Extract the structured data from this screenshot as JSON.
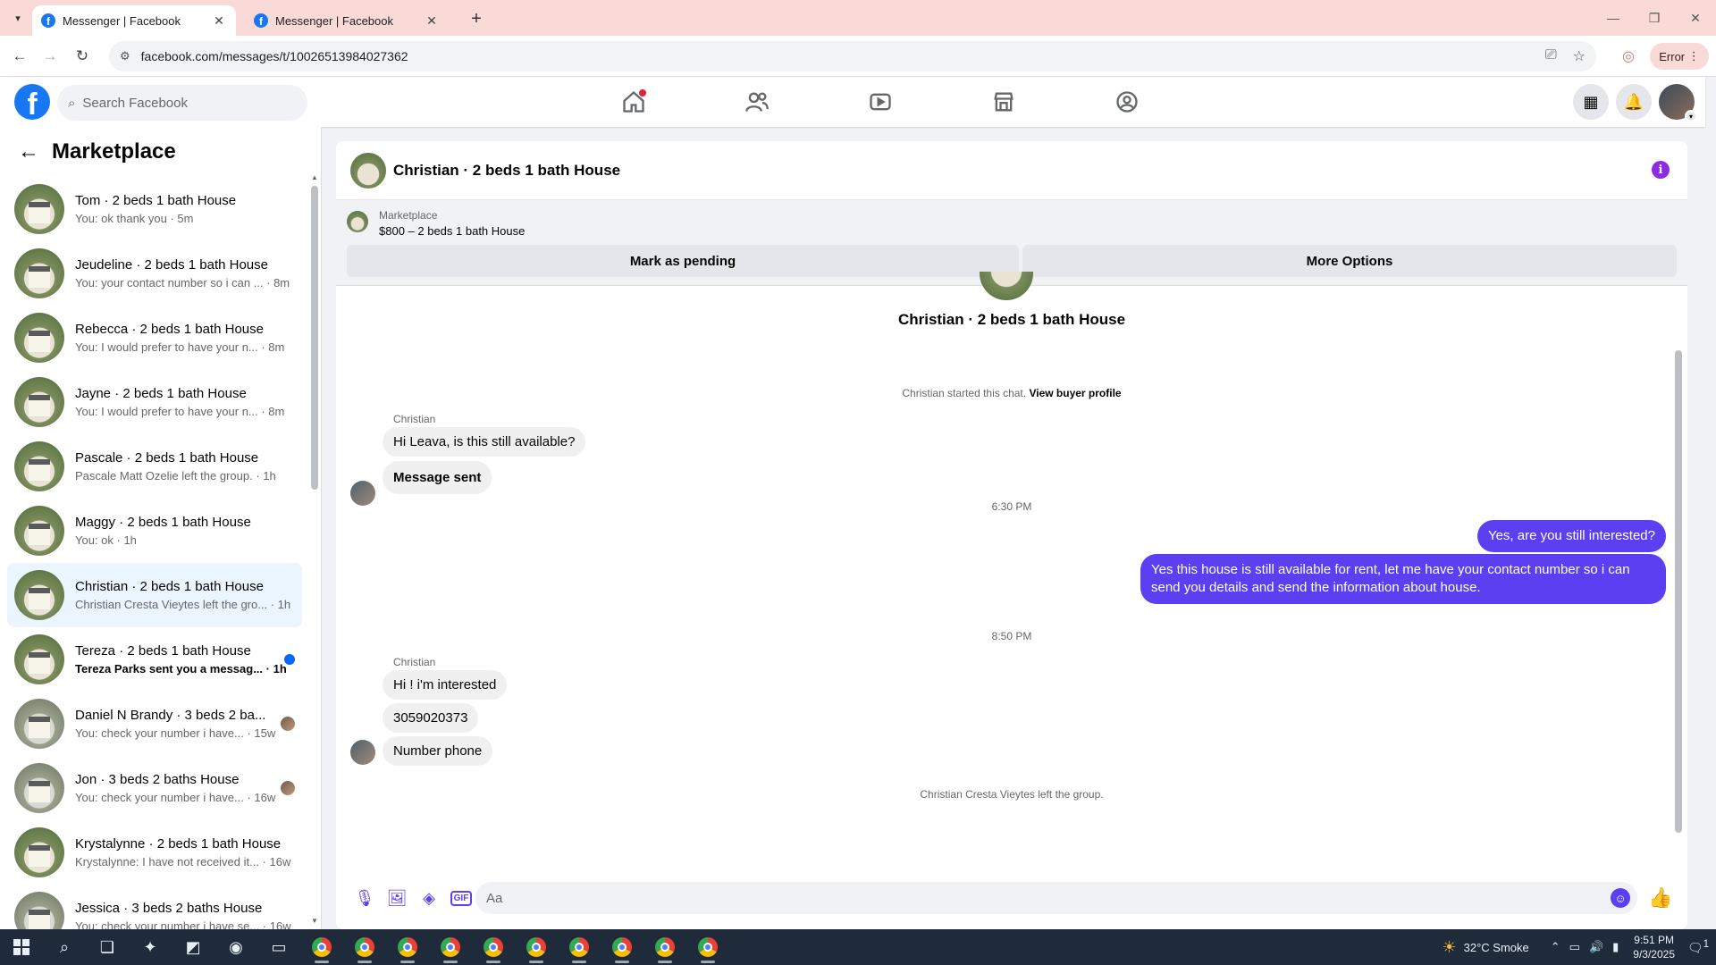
{
  "browser": {
    "tabs": [
      {
        "title": "Messenger | Facebook",
        "active": true
      },
      {
        "title": "Messenger | Facebook",
        "active": false
      }
    ],
    "url": "facebook.com/messages/t/10026513984027362",
    "error_label": "Error"
  },
  "fb_header": {
    "search_placeholder": "Search Facebook",
    "nav_icons": [
      "home-icon",
      "friends-icon",
      "video-icon",
      "marketplace-icon",
      "groups-icon"
    ],
    "accent_color": "#1877f2"
  },
  "sidebar": {
    "title": "Marketplace",
    "conversations": [
      {
        "name": "Tom · 2 beds 1 bath House",
        "preview": "You: ok thank you · 5m"
      },
      {
        "name": "Jeudeline · 2 beds 1 bath House",
        "preview": "You: your contact number so i can ... · 8m"
      },
      {
        "name": "Rebecca · 2 beds 1 bath House",
        "preview": "You: I would prefer to have your n... · 8m"
      },
      {
        "name": "Jayne · 2 beds 1 bath House",
        "preview": "You: I would prefer to have your n... · 8m"
      },
      {
        "name": "Pascale · 2 beds 1 bath House",
        "preview": "Pascale Matt Ozelie left the group. · 1h"
      },
      {
        "name": "Maggy · 2 beds 1 bath House",
        "preview": "You: ok · 1h"
      },
      {
        "name": "Christian · 2 beds 1 bath House",
        "preview": "Christian Cresta Vieytes left the gro... · 1h"
      },
      {
        "name": "Tereza · 2 beds 1 bath House",
        "preview": "Tereza Parks sent you a messag... · 1h"
      },
      {
        "name": "Daniel N Brandy · 3 beds 2 ba...",
        "preview": "You: check your number i have... · 15w"
      },
      {
        "name": "Jon · 3 beds 2 baths House",
        "preview": "You: check your number i have... · 16w"
      },
      {
        "name": "Krystalynne · 2 beds 1 bath House",
        "preview": "Krystalynne: I have not received it... · 16w"
      },
      {
        "name": "Jessica · 3 beds 2 baths House",
        "preview": "You: check your number i have se... · 16w"
      }
    ]
  },
  "chat": {
    "title": "Christian · 2 beds 1 bath House",
    "listing": {
      "source": "Marketplace",
      "price_title": "$800 – 2 beds 1 bath House",
      "mark_pending_label": "Mark as pending",
      "more_options_label": "More Options"
    },
    "thread_title": "Christian · 2 beds 1 bath House",
    "started_text": "Christian started this chat.",
    "view_profile_label": "View buyer profile",
    "sender_name": "Christian",
    "messages_group1": [
      "Hi Leava, is this still available?",
      "Message sent"
    ],
    "time1": "6:30 PM",
    "outgoing": [
      "Yes, are you still interested?",
      "Yes this house is still available for rent, let me have your contact number so i can send you details and send the information about house."
    ],
    "time2": "8:50 PM",
    "messages_group2": [
      "Hi ! i'm interested",
      "3059020373",
      "Number phone"
    ],
    "left_group_text": "Christian Cresta Vieytes left the group.",
    "composer_placeholder": "Aa",
    "accent_color": "#5b3ff0"
  },
  "taskbar": {
    "weather": "32°C  Smoke",
    "time": "9:51 PM",
    "date": "9/3/2025",
    "notification_count": "1"
  }
}
